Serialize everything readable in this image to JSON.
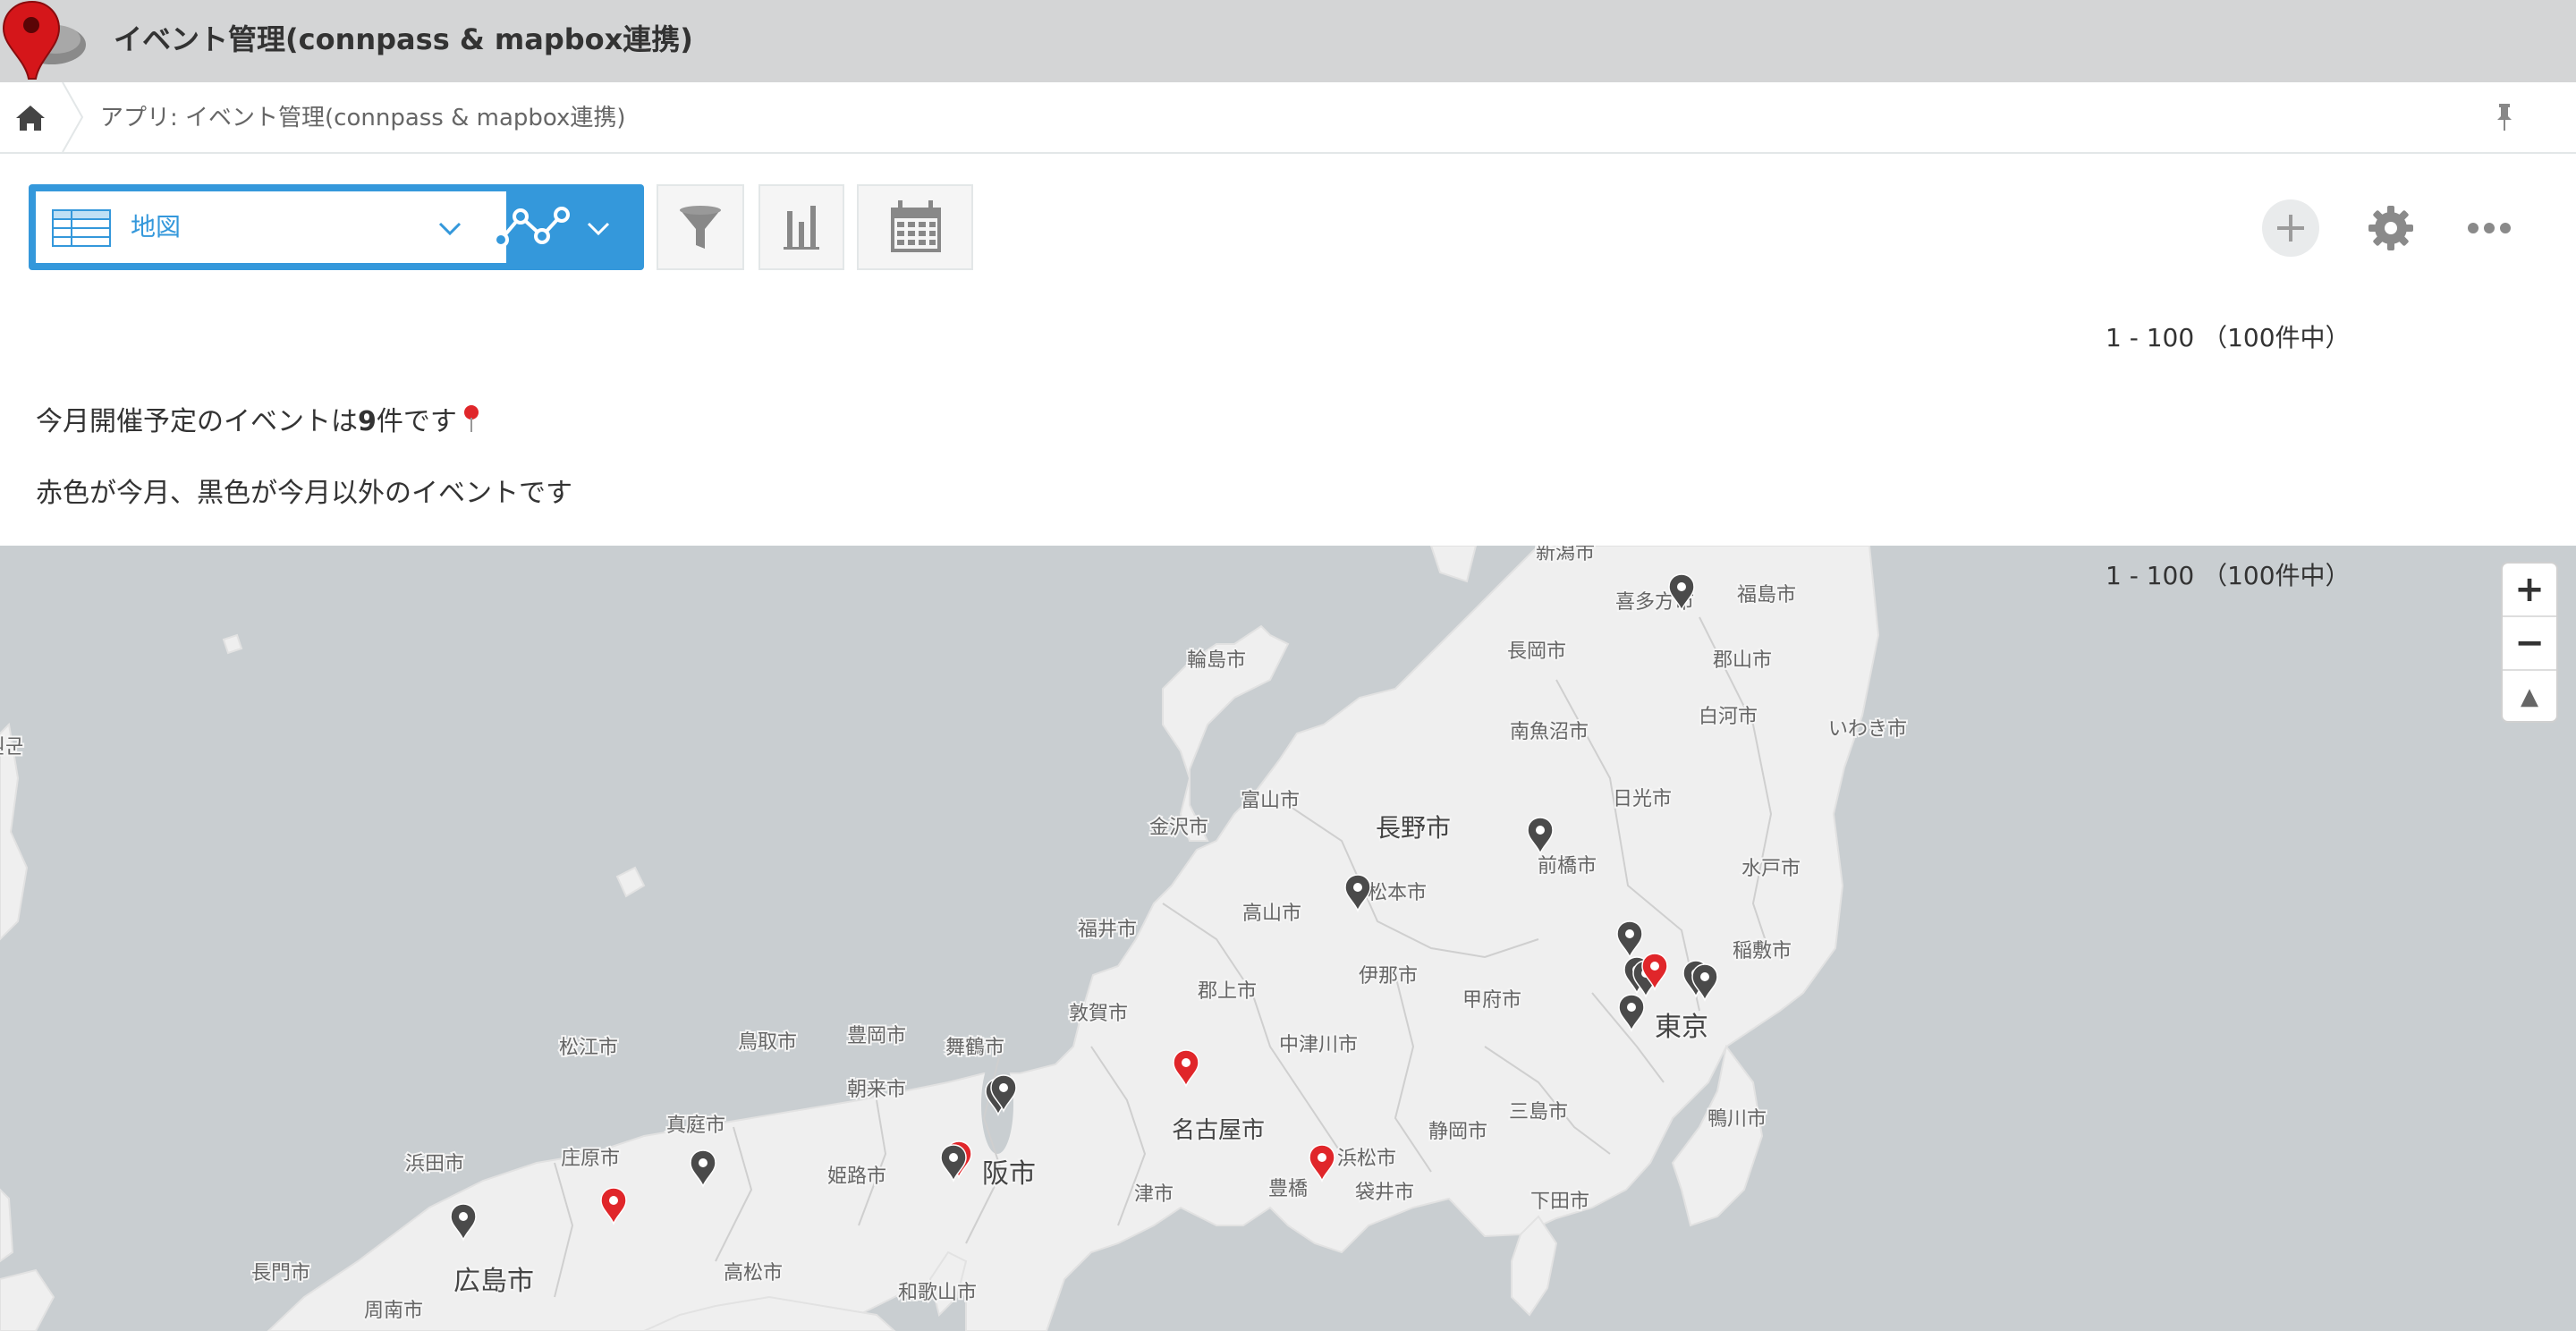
{
  "app": {
    "title": "イベント管理(connpass & mapbox連携)"
  },
  "breadcrumb": {
    "text": "アプリ: イベント管理(connpass & mapbox連携)"
  },
  "view": {
    "name": "地図"
  },
  "records": {
    "range": "1 - 100 （100件中）"
  },
  "message": {
    "line1_prefix": "今月開催予定のイベントは",
    "line1_count": "9",
    "line1_suffix": "件です",
    "line2": "赤色が今月、黒色が今月以外のイベントです"
  },
  "map_controls": {
    "zoom_in": "+",
    "zoom_out": "−",
    "compass": "▲"
  },
  "colors": {
    "brand_red": "#e0262a",
    "accent_blue": "#3498db",
    "pin_dark": "#4a4a4a",
    "header_gray": "#d4d5d6"
  },
  "map": {
    "labels": [
      {
        "id": "niigata",
        "text": "新潟市"
      },
      {
        "id": "kitakata",
        "text": "喜多方市"
      },
      {
        "id": "fukushima",
        "text": "福島市"
      },
      {
        "id": "nagaoka",
        "text": "長岡市"
      },
      {
        "id": "koriyama",
        "text": "郡山市"
      },
      {
        "id": "wajima",
        "text": "輪島市"
      },
      {
        "id": "shirakawa",
        "text": "白河市"
      },
      {
        "id": "minamiuonuma",
        "text": "南魚沼市"
      },
      {
        "id": "iwaki",
        "text": "いわき市"
      },
      {
        "id": "nikko",
        "text": "日光市"
      },
      {
        "id": "toyama",
        "text": "富山市"
      },
      {
        "id": "kanazawa",
        "text": "金沢市"
      },
      {
        "id": "nagano",
        "text": "長野市"
      },
      {
        "id": "maebashi",
        "text": "前橋市"
      },
      {
        "id": "matsumoto",
        "text": "松本市"
      },
      {
        "id": "mito",
        "text": "水戸市"
      },
      {
        "id": "takayama",
        "text": "高山市"
      },
      {
        "id": "fukui",
        "text": "福井市"
      },
      {
        "id": "inashiki",
        "text": "稲敷市"
      },
      {
        "id": "ina",
        "text": "伊那市"
      },
      {
        "id": "kofu",
        "text": "甲府市"
      },
      {
        "id": "gujo",
        "text": "郡上市"
      },
      {
        "id": "tokyo",
        "text": "東京"
      },
      {
        "id": "tsuruga",
        "text": "敦賀市"
      },
      {
        "id": "nakatsugawa",
        "text": "中津川市"
      },
      {
        "id": "matsue",
        "text": "松江市"
      },
      {
        "id": "tottori",
        "text": "鳥取市"
      },
      {
        "id": "toyooka",
        "text": "豊岡市"
      },
      {
        "id": "maizuru",
        "text": "舞鶴市"
      },
      {
        "id": "asago",
        "text": "朝来市"
      },
      {
        "id": "nagoya",
        "text": "名古屋市"
      },
      {
        "id": "mishima",
        "text": "三島市"
      },
      {
        "id": "kamogawa",
        "text": "鴨川市"
      },
      {
        "id": "maniwa",
        "text": "真庭市"
      },
      {
        "id": "shizuoka",
        "text": "静岡市"
      },
      {
        "id": "hamada",
        "text": "浜田市"
      },
      {
        "id": "shobara",
        "text": "庄原市"
      },
      {
        "id": "himeji",
        "text": "姫路市"
      },
      {
        "id": "osaka",
        "text": "阪市"
      },
      {
        "id": "hamamatsu",
        "text": "浜松市"
      },
      {
        "id": "toyohashi",
        "text": "豊橋"
      },
      {
        "id": "fukuroi",
        "text": "袋井市"
      },
      {
        "id": "tsu",
        "text": "津市"
      },
      {
        "id": "shimoda",
        "text": "下田市"
      },
      {
        "id": "nagato",
        "text": "長門市"
      },
      {
        "id": "takamatsu",
        "text": "高松市"
      },
      {
        "id": "hiroshima",
        "text": "広島市"
      },
      {
        "id": "wakayama",
        "text": "和歌山市"
      },
      {
        "id": "shunan",
        "text": "周南市"
      },
      {
        "id": "korea_edge",
        "text": "원군"
      }
    ],
    "markers": [
      {
        "id": "m1",
        "status": "other"
      },
      {
        "id": "m2",
        "status": "other"
      },
      {
        "id": "m3",
        "status": "other"
      },
      {
        "id": "m4",
        "status": "other"
      },
      {
        "id": "m5",
        "status": "other"
      },
      {
        "id": "m6",
        "status": "other"
      },
      {
        "id": "m7",
        "status": "this_month"
      },
      {
        "id": "m8",
        "status": "other"
      },
      {
        "id": "m9",
        "status": "other"
      },
      {
        "id": "m10",
        "status": "other"
      },
      {
        "id": "m11",
        "status": "this_month"
      },
      {
        "id": "m12",
        "status": "other"
      },
      {
        "id": "m13",
        "status": "other"
      },
      {
        "id": "m14",
        "status": "this_month"
      },
      {
        "id": "m15",
        "status": "other"
      },
      {
        "id": "m16",
        "status": "this_month"
      },
      {
        "id": "m17",
        "status": "other"
      },
      {
        "id": "m18",
        "status": "this_month"
      },
      {
        "id": "m19",
        "status": "other"
      }
    ]
  }
}
